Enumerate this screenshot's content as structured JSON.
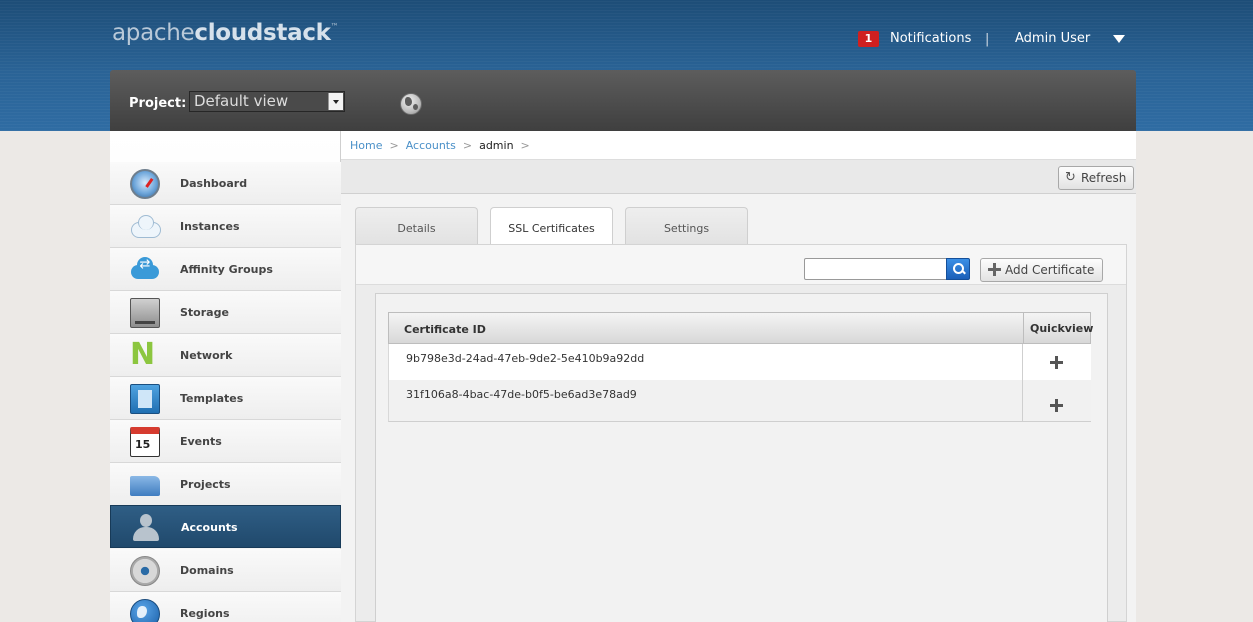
{
  "header": {
    "logo_light": "apache",
    "logo_bold": "cloudstack",
    "logo_tm": "™",
    "notification_count": "1",
    "notifications_label": "Notifications",
    "separator": "|",
    "user_label": "Admin User"
  },
  "project_bar": {
    "label": "Project:",
    "selected": "Default view"
  },
  "sidebar": {
    "items": [
      {
        "label": "Dashboard",
        "icon": "dashboard-icon"
      },
      {
        "label": "Instances",
        "icon": "cloud-icon"
      },
      {
        "label": "Affinity Groups",
        "icon": "affinity-cloud-icon"
      },
      {
        "label": "Storage",
        "icon": "storage-icon"
      },
      {
        "label": "Network",
        "icon": "network-icon"
      },
      {
        "label": "Templates",
        "icon": "templates-icon"
      },
      {
        "label": "Events",
        "icon": "calendar-icon"
      },
      {
        "label": "Projects",
        "icon": "folder-icon"
      },
      {
        "label": "Accounts",
        "icon": "user-icon"
      },
      {
        "label": "Domains",
        "icon": "domains-icon"
      },
      {
        "label": "Regions",
        "icon": "globe-icon"
      }
    ],
    "active": "Accounts"
  },
  "breadcrumb": {
    "home": "Home",
    "accounts": "Accounts",
    "current": "admin",
    "sep": ">"
  },
  "toolbar": {
    "refresh_label": "Refresh"
  },
  "tabs": [
    {
      "label": "Details"
    },
    {
      "label": "SSL Certificates"
    },
    {
      "label": "Settings"
    }
  ],
  "active_tab": "SSL Certificates",
  "actions": {
    "search_value": "",
    "add_certificate_label": "Add Certificate"
  },
  "grid": {
    "headers": [
      "Certificate ID",
      "Quickview"
    ],
    "rows": [
      {
        "certificate_id": "9b798e3d-24ad-47eb-9de2-5e410b9a92dd"
      },
      {
        "certificate_id": "31f106a8-4bac-47de-b0f5-be6ad3e78ad9"
      }
    ]
  },
  "colors": {
    "banner": "#2a6396",
    "sidebar_active": "#2f5e85",
    "link": "#4a90c8",
    "notification_badge": "#cf2020",
    "search_button": "#1b5fb8"
  }
}
